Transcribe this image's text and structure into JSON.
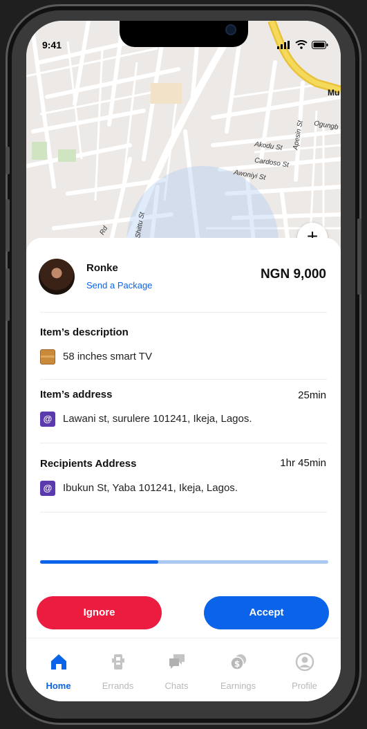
{
  "status_bar": {
    "time": "9:41"
  },
  "map": {
    "labels": [
      "Mu",
      "Ogungb",
      "Apesin St",
      "Akodu St",
      "Cardoso St",
      "Awoniyi St",
      "Shittu St",
      "Rd"
    ],
    "zoom_label": "+"
  },
  "request": {
    "user_name": "Ronke",
    "action": "Send a Package",
    "price": "NGN 9,000"
  },
  "item_description": {
    "title": "Item’s description",
    "icon": "package-icon",
    "value": "58 inches smart TV"
  },
  "item_address": {
    "title": "Item’s address",
    "eta": "25min",
    "icon": "at-icon",
    "value": "Lawani st, surulere 101241, Ikeja, Lagos."
  },
  "recipient_address": {
    "title": "Recipients Address",
    "eta": "1hr 45min",
    "icon": "at-icon",
    "value": "Ibukun St, Yaba 101241, Ikeja, Lagos."
  },
  "progress": {
    "fraction": 0.41
  },
  "actions": {
    "ignore": "Ignore",
    "accept": "Accept"
  },
  "colors": {
    "primary": "#0A63E8",
    "danger": "#EC1C41",
    "inactive": "#B8B8B8"
  },
  "tabs": [
    {
      "label": "Home",
      "icon": "home-icon",
      "active": true
    },
    {
      "label": "Errands",
      "icon": "errands-icon",
      "active": false
    },
    {
      "label": "Chats",
      "icon": "chats-icon",
      "active": false
    },
    {
      "label": "Earnings",
      "icon": "earnings-icon",
      "active": false
    },
    {
      "label": "Profile",
      "icon": "profile-icon",
      "active": false
    }
  ]
}
